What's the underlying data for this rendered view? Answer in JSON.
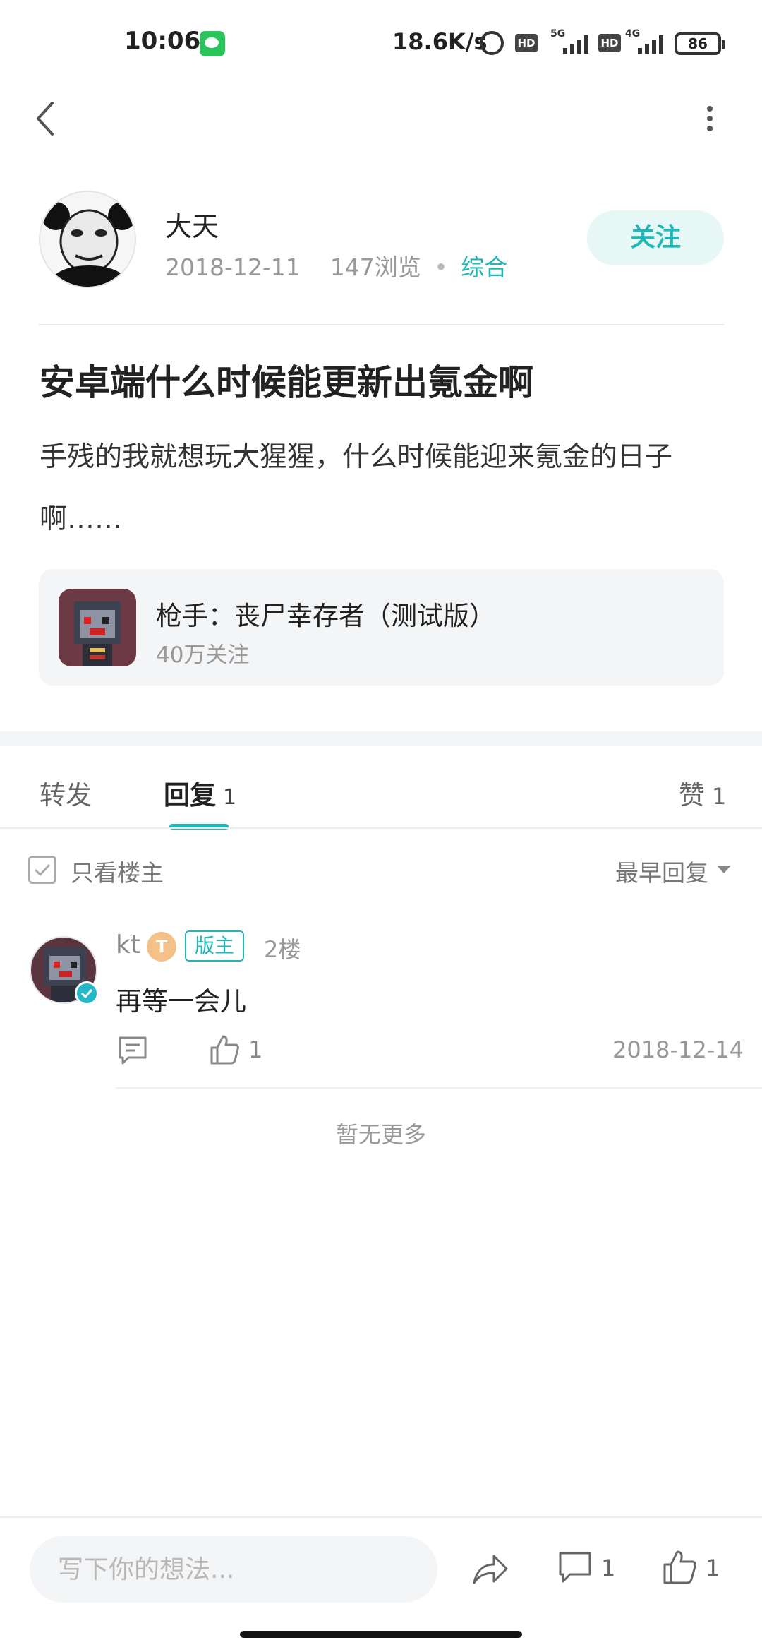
{
  "status_bar": {
    "time": "10:06",
    "net_speed": "18.6K/s",
    "hd_label": "HD",
    "sim1_network": "5G",
    "sim2_network": "4G",
    "battery": "86"
  },
  "post": {
    "author_name": "大天",
    "date": "2018-12-11",
    "views": "147浏览",
    "separator": "•",
    "category": "综合",
    "follow_label": "关注",
    "title": "安卓端什么时候能更新出氪金啊",
    "body": "手残的我就想玩大猩猩，什么时候能迎来氪金的日子啊……"
  },
  "game_card": {
    "name": "枪手：丧尸幸存者（测试版）",
    "followers": "40万关注"
  },
  "tabs": {
    "forward": "转发",
    "reply": "回复",
    "reply_count": "1",
    "like": "赞",
    "like_count": "1"
  },
  "filter": {
    "only_op": "只看楼主",
    "sort": "最早回复"
  },
  "replies": [
    {
      "user": "kt",
      "level": "T",
      "badge": "版主",
      "floor": "2楼",
      "text": "再等一会儿",
      "likes": "1",
      "date": "2018-12-14"
    }
  ],
  "no_more": "暂无更多",
  "bottom_bar": {
    "input_placeholder": "写下你的想法...",
    "comment_count": "1",
    "like_count": "1"
  },
  "colors": {
    "accent": "#1fb8b8",
    "follow_bg": "#e6f7f6",
    "card_bg": "#f4f5f7"
  }
}
